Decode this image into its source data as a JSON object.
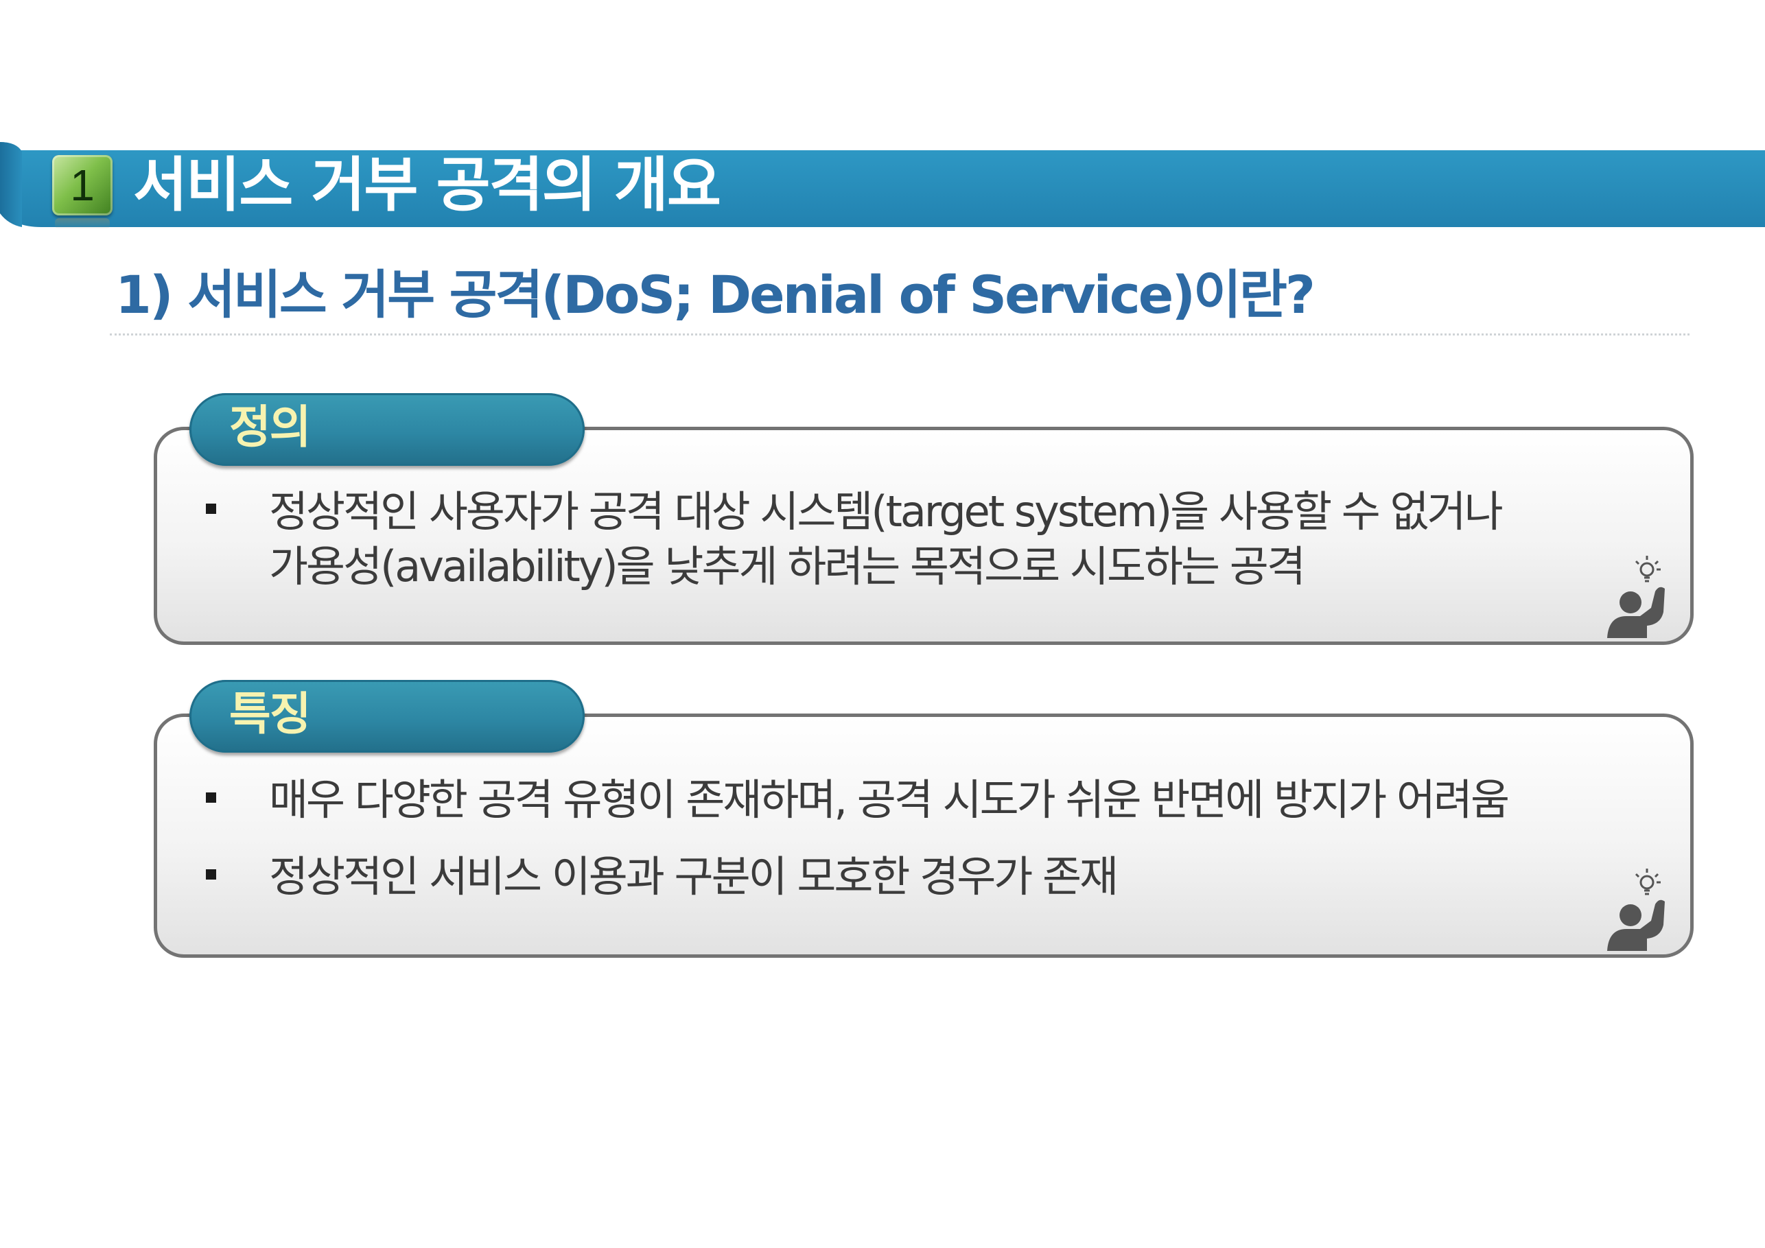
{
  "header": {
    "section_number": "1",
    "title": "서비스 거부 공격의 개요",
    "bar_color": "#2a8fbd"
  },
  "subtitle": "1) 서비스 거부 공격(DoS; Denial of Service)이란?",
  "definition": {
    "tab_label": "정의",
    "lines": [
      "정상적인 사용자가 공격 대상 시스템(target system)을 사용할 수 없거나",
      "가용성(availability)을 낮추게 하려는 목적으로 시도하는 공격"
    ],
    "icon": "person-idea-icon"
  },
  "features": {
    "tab_label": "특징",
    "items": [
      "매우 다양한 공격 유형이 존재하며, 공격 시도가 쉬운 반면에 방지가 어려움",
      "정상적인 서비스 이용과 구분이 모호한 경우가 존재"
    ],
    "icon": "person-idea-icon"
  },
  "colors": {
    "tab_label": "#f7f3b0",
    "subtitle": "#2e6aa3",
    "box_border": "#737373"
  }
}
